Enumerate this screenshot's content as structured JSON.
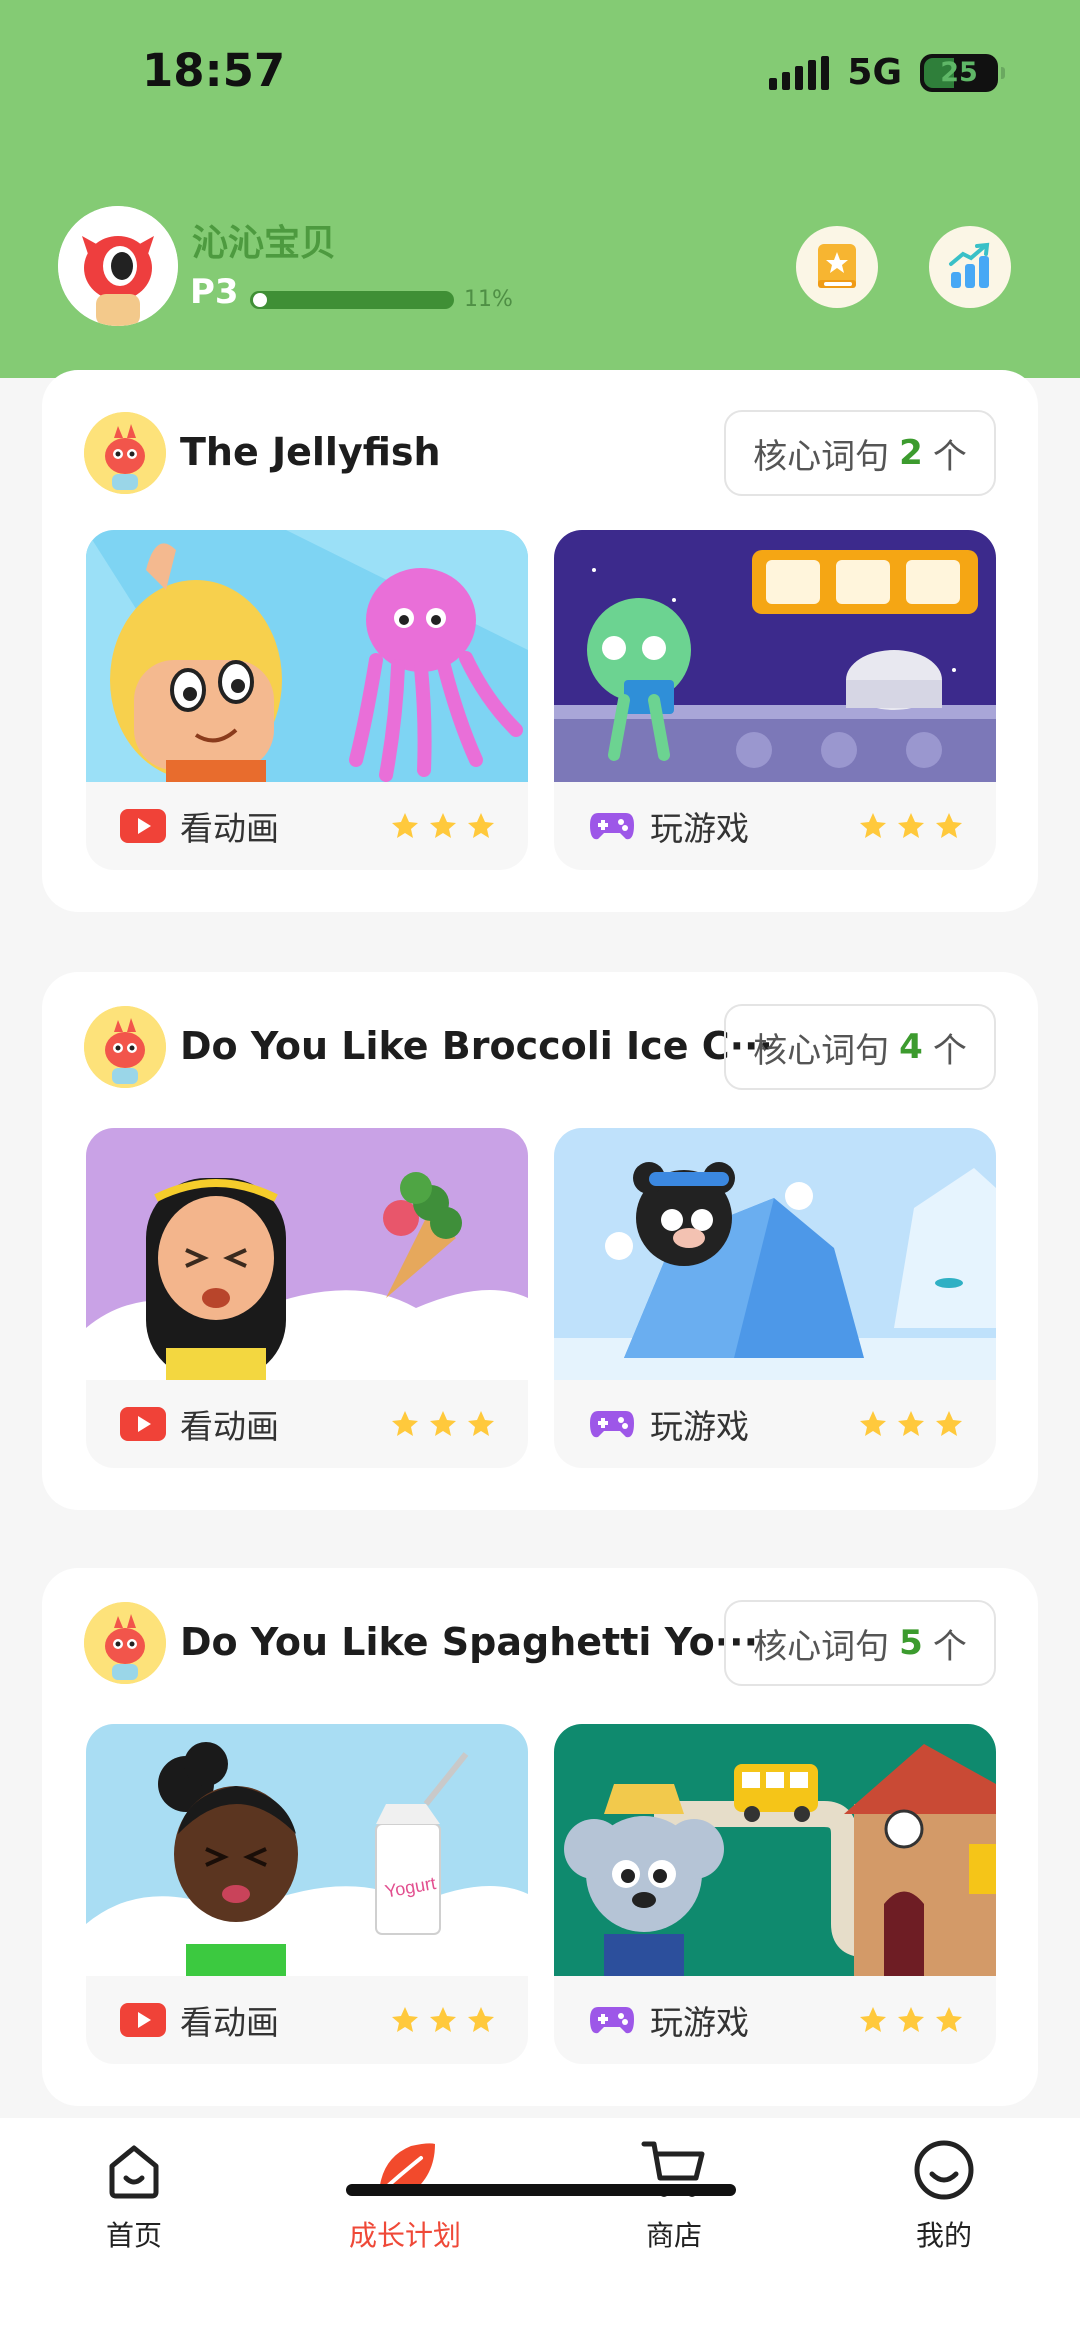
{
  "status_bar": {
    "time": "18:57",
    "network": "5G",
    "battery": "25"
  },
  "profile": {
    "name": "沁沁宝贝",
    "level": "P3",
    "progress_percent": 11,
    "progress_label": "11%"
  },
  "lessons": [
    {
      "title": "The Jellyfish",
      "core_label": "核心词句",
      "core_count": "2",
      "core_unit": "个",
      "video_label": "看动画",
      "video_stars": 3,
      "game_label": "玩游戏",
      "game_stars": 3
    },
    {
      "title": "Do You Like Broccoli Ice C···",
      "core_label": "核心词句",
      "core_count": "4",
      "core_unit": "个",
      "video_label": "看动画",
      "video_stars": 3,
      "game_label": "玩游戏",
      "game_stars": 3,
      "game_art_text": ""
    },
    {
      "title": "Do You Like Spaghetti Yo···",
      "core_label": "核心词句",
      "core_count": "5",
      "core_unit": "个",
      "video_label": "看动画",
      "video_stars": 3,
      "game_label": "玩游戏",
      "game_stars": 3,
      "video_art_text": "Yogurt"
    }
  ],
  "tabs": [
    {
      "label": "首页",
      "icon": "home-icon",
      "active": false
    },
    {
      "label": "成长计划",
      "icon": "leaf-icon",
      "active": true
    },
    {
      "label": "商店",
      "icon": "cart-icon",
      "active": false
    },
    {
      "label": "我的",
      "icon": "smile-icon",
      "active": false
    }
  ],
  "colors": {
    "header": "#84cb74",
    "accent_green": "#3c9b2e",
    "active_tab": "#ef4938",
    "star": "#ffc93c"
  }
}
